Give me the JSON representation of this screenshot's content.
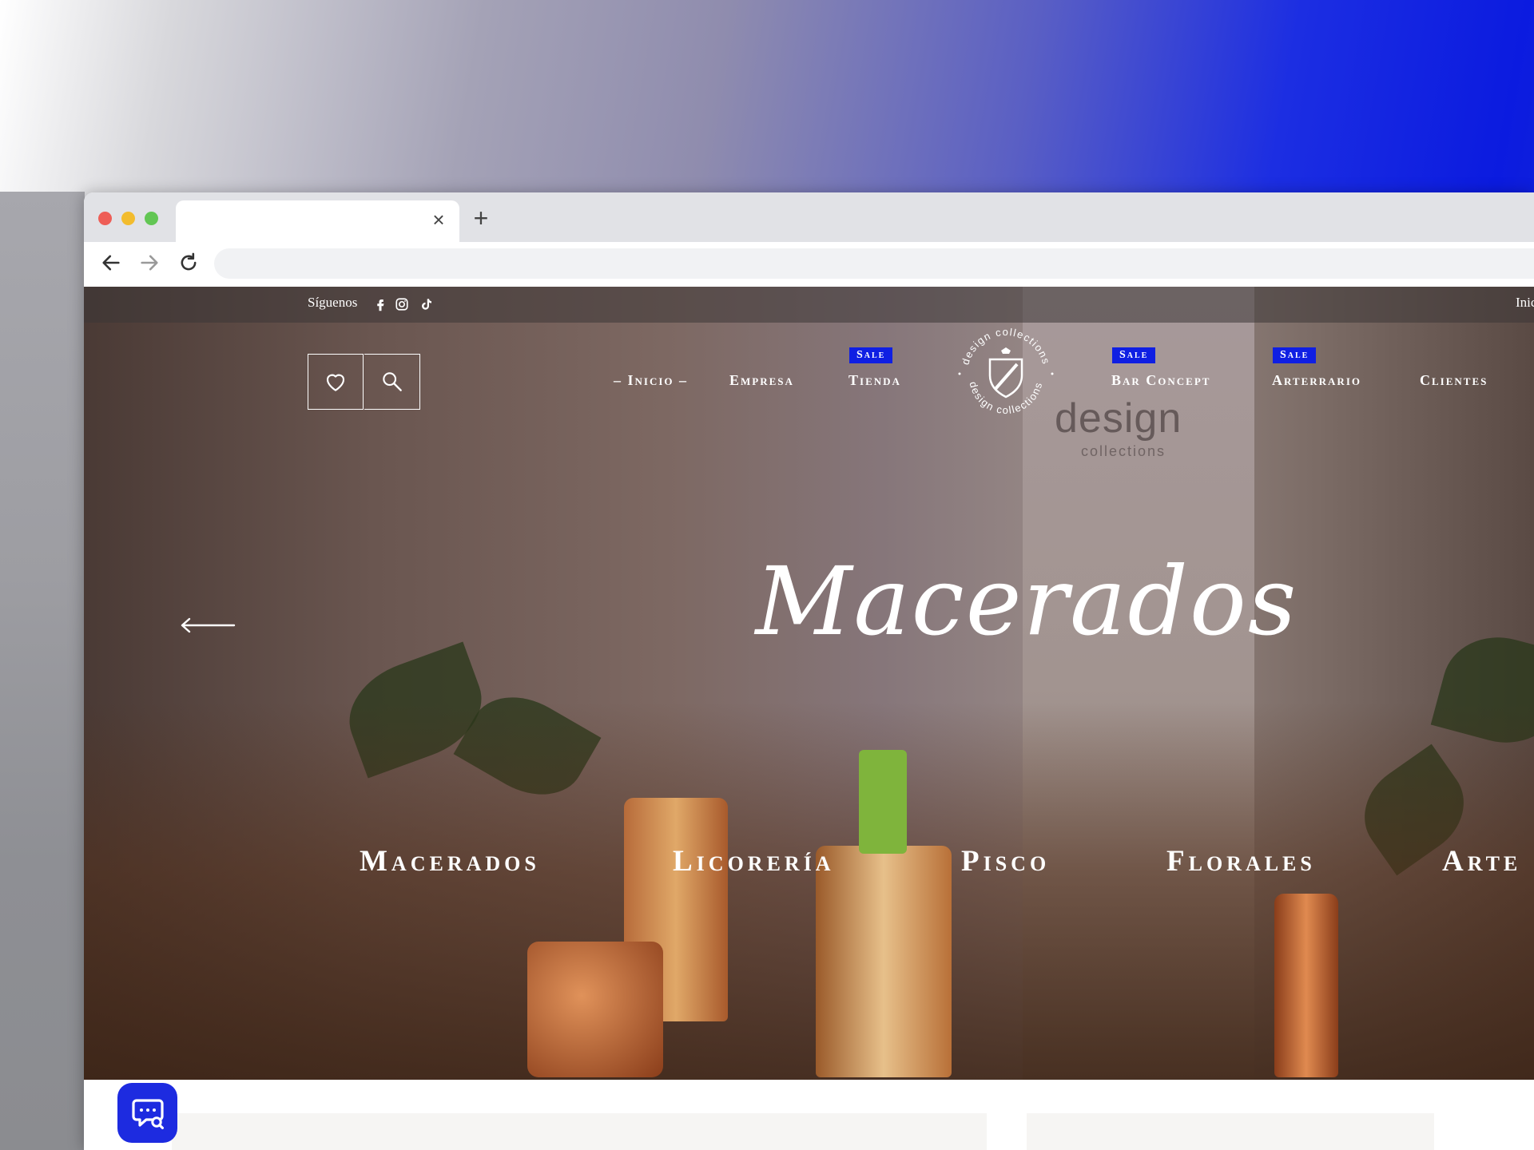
{
  "browser": {
    "tab_close": "×",
    "new_tab": "+"
  },
  "topbar": {
    "follow_label": "Síguenos",
    "social": [
      "facebook-icon",
      "instagram-icon",
      "tiktok-icon"
    ],
    "right_link": "Inic"
  },
  "nav": {
    "items": [
      {
        "label": "– Inicio –",
        "sale": false
      },
      {
        "label": "Empresa",
        "sale": false
      },
      {
        "label": "Tienda",
        "sale": true
      },
      {
        "label": "Bar Concept",
        "sale": true
      },
      {
        "label": "Arterrario",
        "sale": true
      },
      {
        "label": "Clientes",
        "sale": false
      }
    ],
    "sale_badge": "Sale"
  },
  "logo": {
    "text": "design collections"
  },
  "hero": {
    "title": "Macerados"
  },
  "categories": [
    "Macerados",
    "Licorería",
    "Pisco",
    "Florales",
    "Arte"
  ],
  "background_box": {
    "brand": "design",
    "sub": "collections"
  },
  "colors": {
    "sale_badge": "#0f1fe3",
    "chat_button": "#1d2be0"
  }
}
